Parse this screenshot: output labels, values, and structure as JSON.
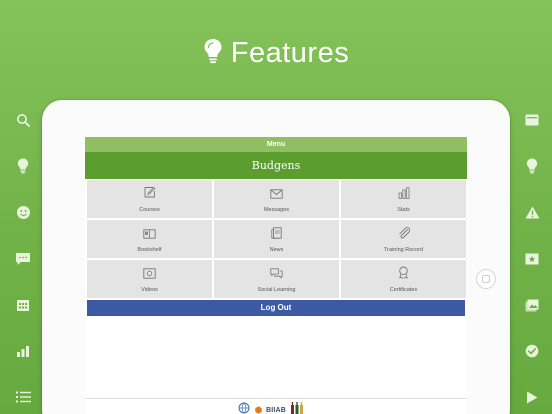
{
  "header": {
    "title": "Features",
    "icon": "lightbulb-icon"
  },
  "left_rail": [
    {
      "name": "search-icon"
    },
    {
      "name": "lightbulb-icon"
    },
    {
      "name": "smiley-icon"
    },
    {
      "name": "chat-icon"
    },
    {
      "name": "calendar-icon"
    },
    {
      "name": "bar-chart-icon"
    },
    {
      "name": "list-icon"
    }
  ],
  "right_rail": [
    {
      "name": "card-icon"
    },
    {
      "name": "lightbulb-icon"
    },
    {
      "name": "warning-icon"
    },
    {
      "name": "certificate-icon"
    },
    {
      "name": "photo-icon"
    },
    {
      "name": "checkmark-icon"
    },
    {
      "name": "play-icon"
    }
  ],
  "app": {
    "menu_title": "Menu",
    "brand_name": "Budgens",
    "tiles": [
      {
        "label": "Courses",
        "icon": "pencil-edit-icon"
      },
      {
        "label": "Messages",
        "icon": "envelope-icon"
      },
      {
        "label": "Stats",
        "icon": "bar-chart-icon"
      },
      {
        "label": "Bookshelf",
        "icon": "book-icon"
      },
      {
        "label": "News",
        "icon": "newspaper-icon"
      },
      {
        "label": "Training Record",
        "icon": "paperclip-icon"
      },
      {
        "label": "Videos",
        "icon": "video-icon"
      },
      {
        "label": "Social Learning",
        "icon": "chat-bubbles-icon"
      },
      {
        "label": "Certificates",
        "icon": "award-icon"
      }
    ],
    "logout_label": "Log Out",
    "footer_logo_text": "BIIAB"
  },
  "colors": {
    "background": "#72b349",
    "menu_bar": "#8fbe63",
    "brand_bar": "#5c9d2f",
    "tile": "#e4e4e4",
    "logout": "#3b5aa3"
  }
}
